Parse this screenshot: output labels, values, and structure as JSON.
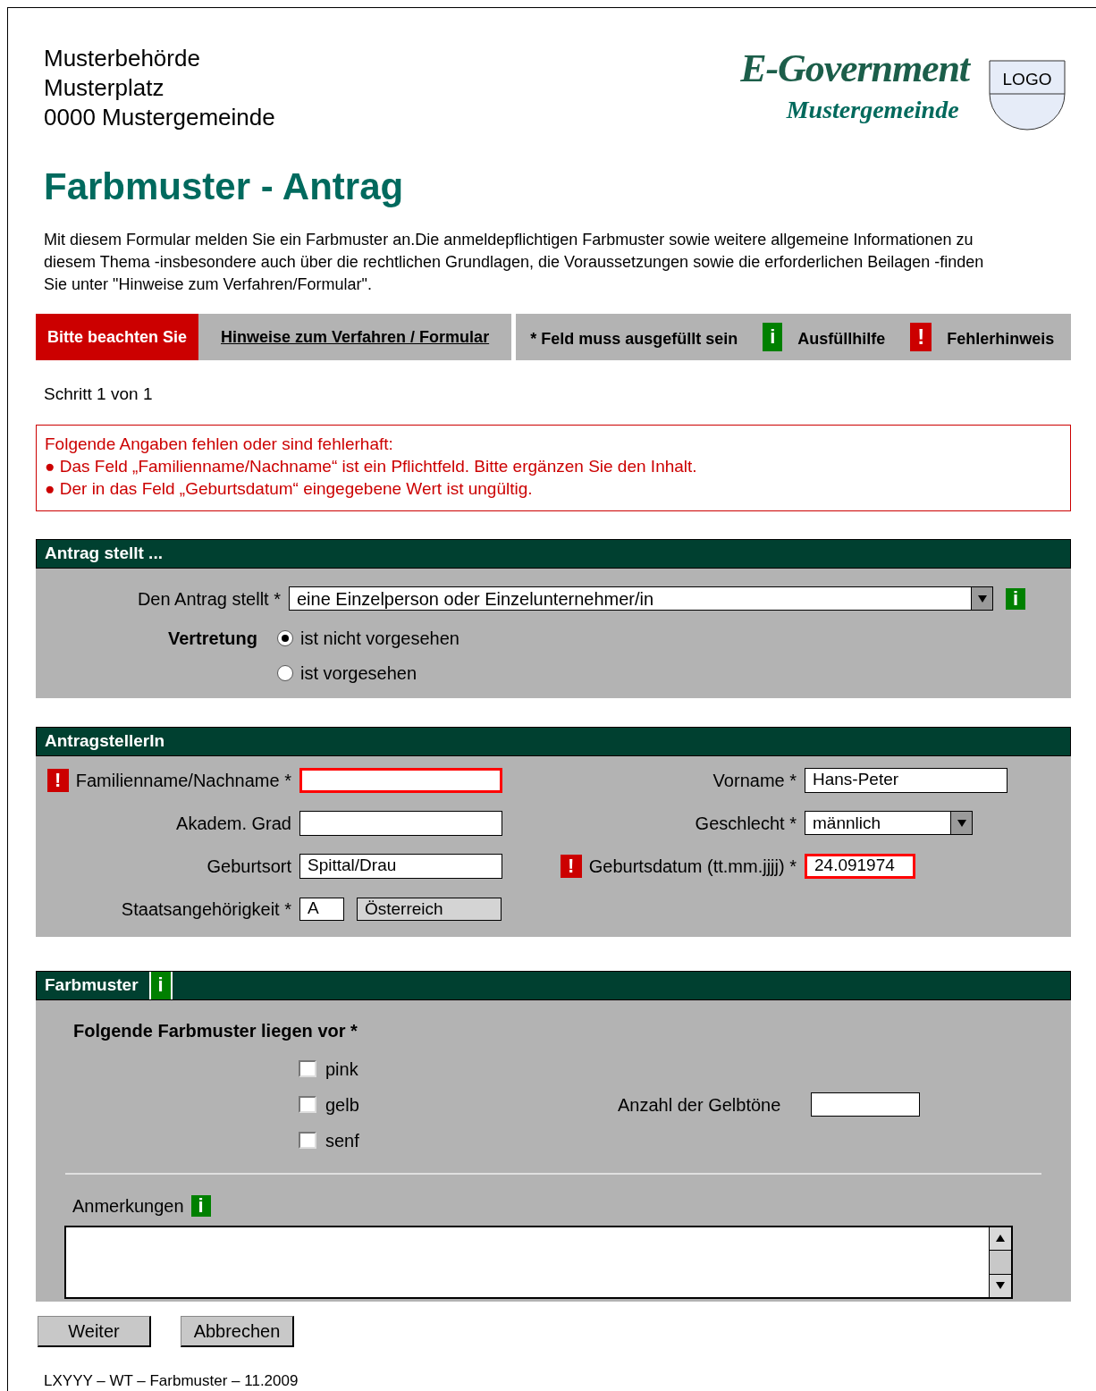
{
  "header": {
    "address": [
      "Musterbehörde",
      "Musterplatz",
      "0000 Mustergemeinde"
    ],
    "logo_title": "E-Government",
    "logo_subtitle": "Mustergemeinde",
    "logo_label": "LOGO"
  },
  "title": "Farbmuster - Antrag",
  "intro": "Mit diesem Formular melden Sie ein Farbmuster an.Die anmeldepflichtigen Farbmuster sowie weitere allgemeine Informationen zu diesem Thema -insbesondere auch über die rechtlichen Grundlagen, die Voraussetzungen sowie die erforderlichen Beilagen -finden Sie unter \"Hinweise zum Verfahren/Formular\".",
  "tabs": [
    {
      "label": "Bitte beachten Sie",
      "selected": true
    },
    {
      "label": "Hinweise zum Verfahren / Formular",
      "selected": false
    }
  ],
  "legend": [
    {
      "kind": "text",
      "label": "* Feld muss ausgefüllt sein"
    },
    {
      "kind": "info",
      "icon": "i",
      "label": "Ausfüllhilfe"
    },
    {
      "kind": "error",
      "icon": "!",
      "label": "Fehlerhinweis"
    }
  ],
  "step": "Schritt 1 von 1",
  "errors": {
    "title": "Folgende Angaben fehlen oder sind fehlerhaft:",
    "items": [
      "● Das Feld „Familienname/Nachname“ ist ein Pflichtfeld. Bitte ergänzen Sie den Inhalt.",
      "● Der in das Feld „Geburtsdatum“ eingegebene Wert ist ungültig."
    ]
  },
  "section_applicant_type": {
    "title": "Antrag stellt ...",
    "select": {
      "label": "Den Antrag stellt *",
      "value": "eine Einzelperson oder Einzelunternehmer/in",
      "info": "i"
    },
    "radio_group": {
      "label": "Vertretung",
      "options": [
        {
          "label": "ist nicht vorgesehen",
          "selected": true
        },
        {
          "label": "ist vorgesehen",
          "selected": false
        }
      ]
    }
  },
  "section_applicant": {
    "title": "AntragstellerIn",
    "rows": [
      {
        "left": {
          "kind": "text",
          "label": "Familienname/Nachname *",
          "error": true,
          "mark": "!"
        },
        "right": {
          "kind": "text",
          "label": "Vorname *",
          "value": "Hans-Peter",
          "error": false
        }
      },
      {
        "left": {
          "kind": "text",
          "label": "Akadem. Grad",
          "error": false
        },
        "right": {
          "kind": "select",
          "label": "Geschlecht *",
          "value": "männlich",
          "error": false
        }
      },
      {
        "left": {
          "kind": "text",
          "label": "Geburtsort",
          "value": "Spittal/Drau",
          "error": false
        },
        "right": {
          "kind": "text",
          "label": "Geburtsdatum (tt.mm.jjjj) *",
          "value": "24.091974",
          "error": true,
          "mark": "!"
        }
      },
      {
        "left": {
          "kind": "pair",
          "label": "Staatsangehörigkeit *",
          "values": [
            "A",
            "Österreich"
          ],
          "error": false
        }
      }
    ]
  },
  "section_samples": {
    "title": "Farbmuster",
    "info": "i",
    "question": "Folgende Farbmuster liegen vor *",
    "options": [
      {
        "label": "pink",
        "checked": false
      },
      {
        "label": "gelb",
        "checked": false,
        "field": {
          "label": "Anzahl der Gelbtöne"
        }
      },
      {
        "label": "senf",
        "checked": false
      }
    ],
    "remarks": {
      "label": "Anmerkungen",
      "info": "i"
    }
  },
  "buttons": [
    "Weiter",
    "Abbrechen"
  ],
  "footer": "LXYYY – WT – Farbmuster – 11.2009"
}
